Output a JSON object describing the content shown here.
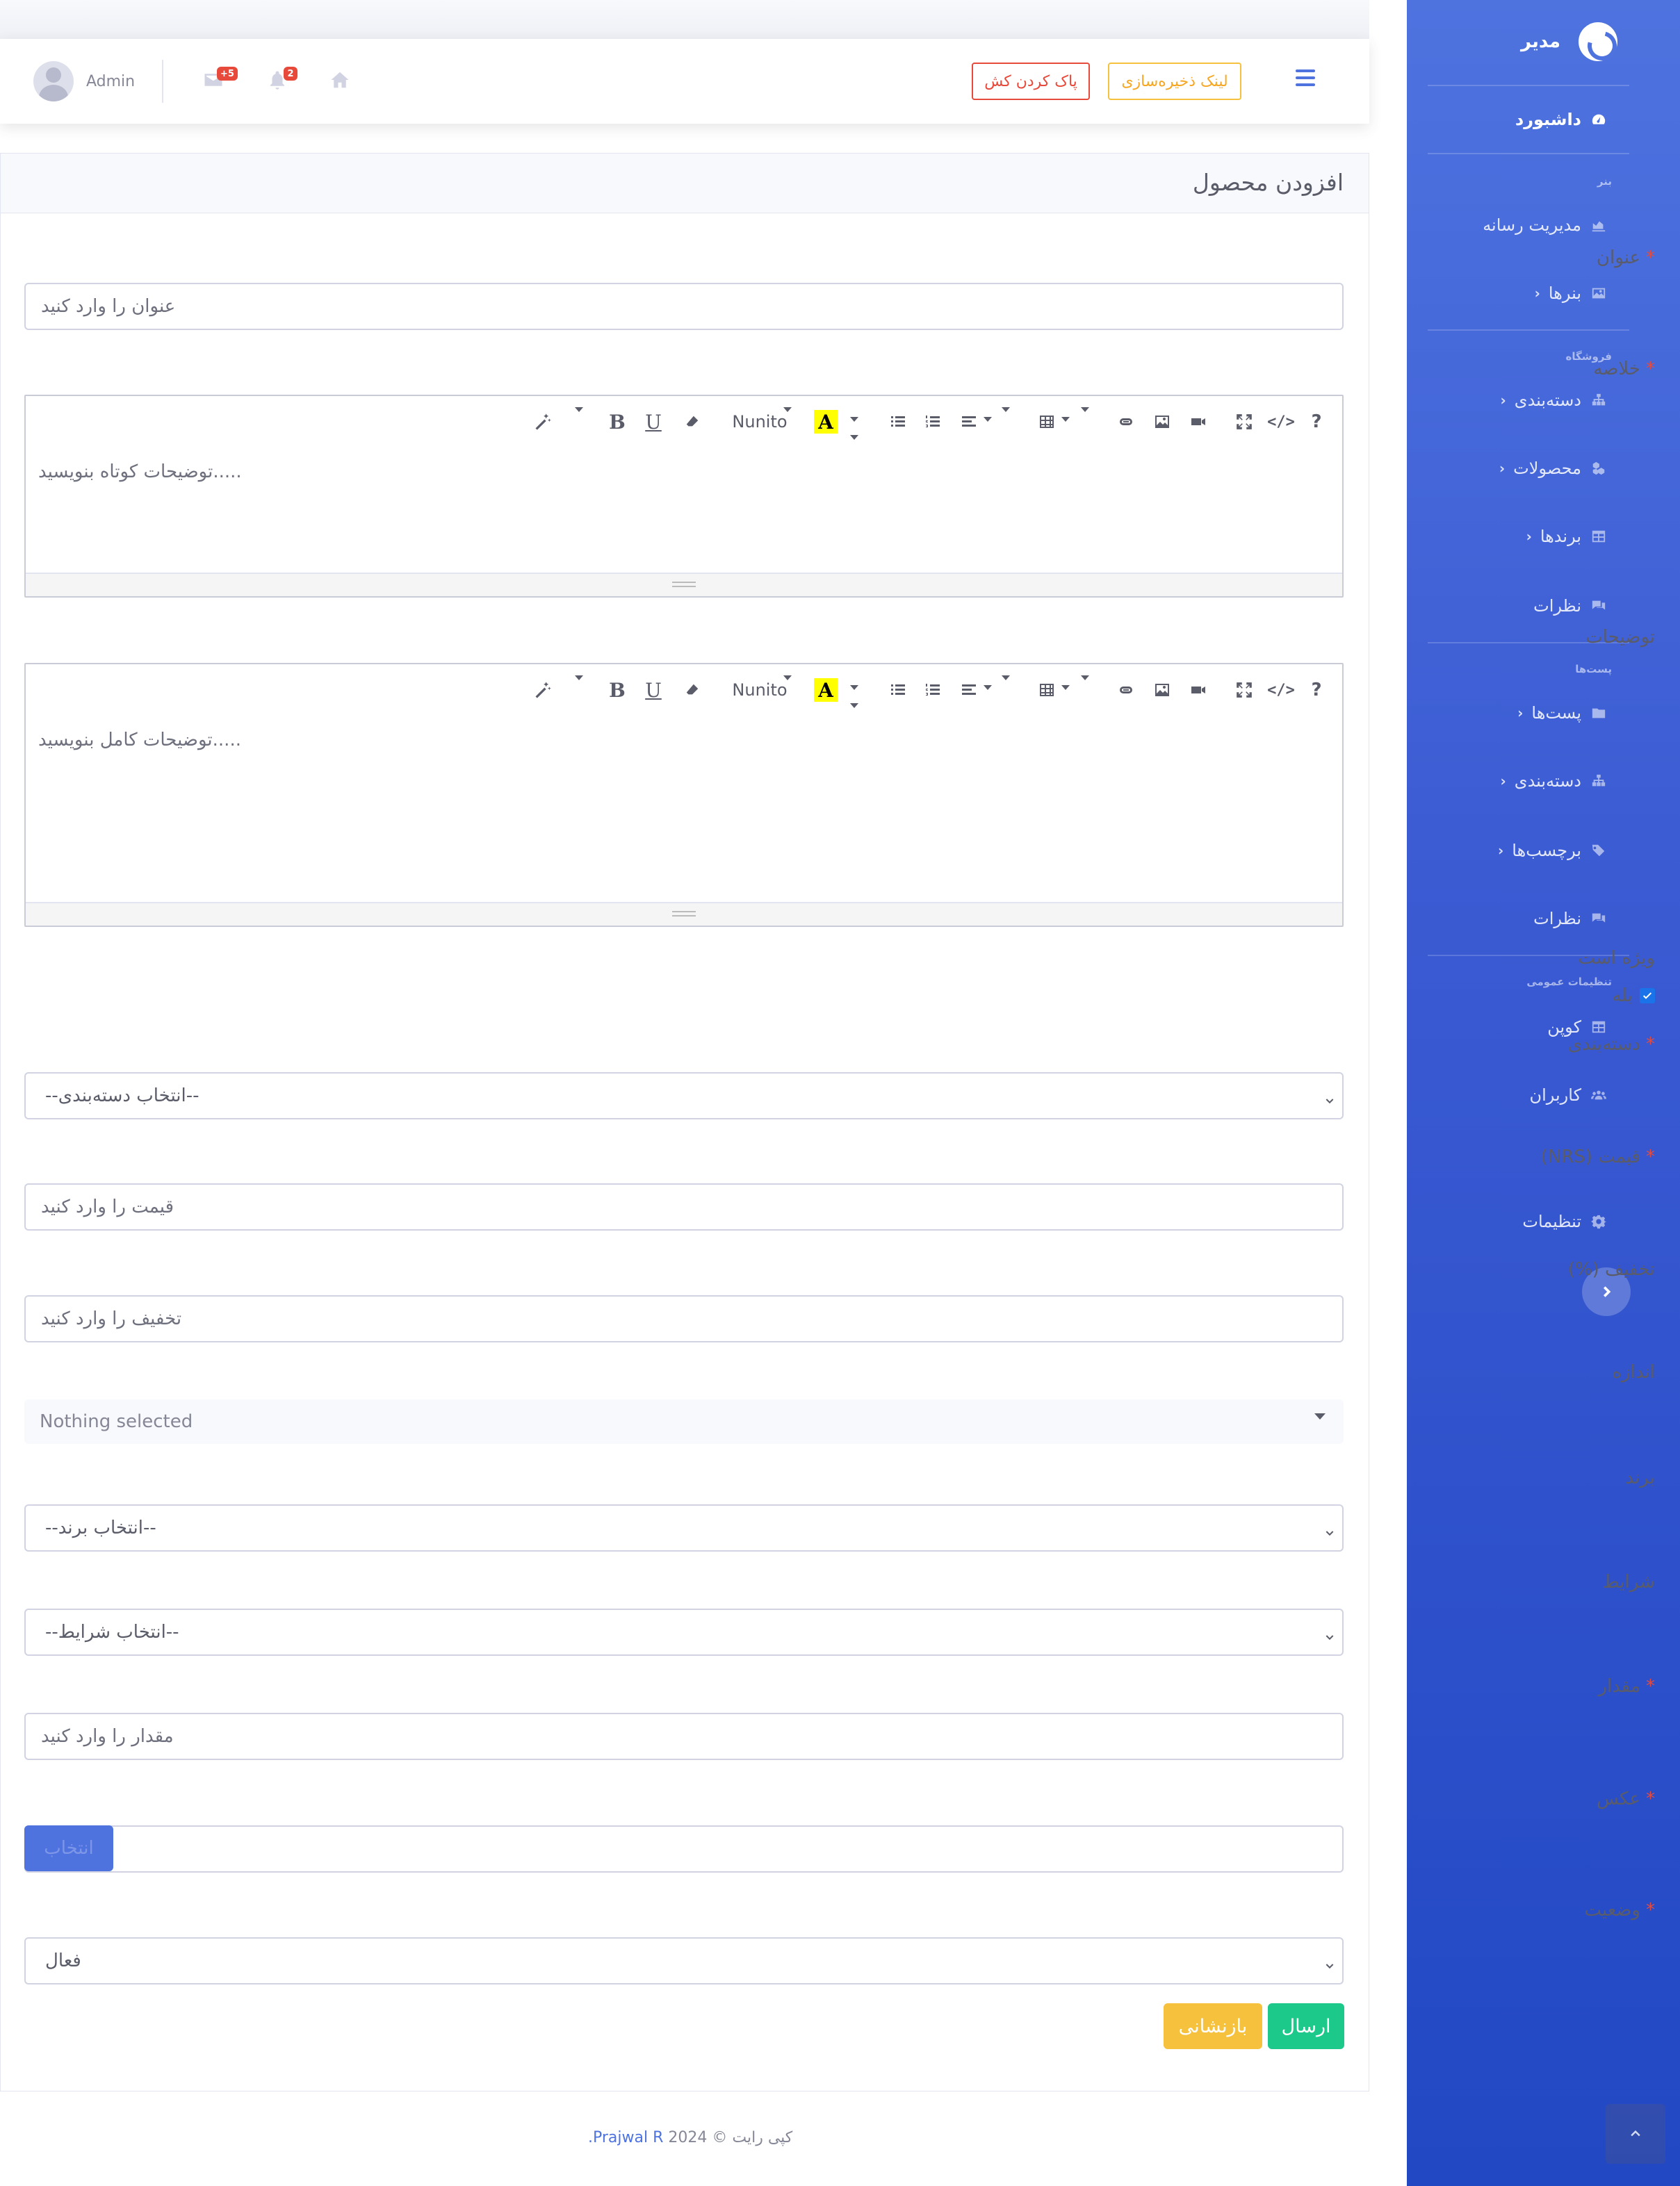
{
  "sidebar": {
    "brand": "مدیر",
    "dashboard": "داشبورد",
    "heading_banner": "بنر",
    "media": "مدیریت رسانه",
    "banners": "بنرها",
    "heading_shop": "فروشگاه",
    "categories": "دسته‌بندی",
    "products": "محصولات",
    "brands": "برندها",
    "comments": "نظرات",
    "heading_posts": "پست‌ها",
    "posts": "پست‌ها",
    "post_categories": "دسته‌بندی",
    "tags": "برچسب‌ها",
    "post_comments": "نظرات",
    "heading_general": "تنظیمات عمومی",
    "coupon": "کوپن",
    "users": "کاربران",
    "settings": "تنظیمات"
  },
  "topbar": {
    "storage_link": "لینک ذخیره‌سازی",
    "clear_cache": "پاک کردن کش",
    "notif_count": "2",
    "messages_count": "+5",
    "user_name": "Admin"
  },
  "form": {
    "page_title": "افزودن محصول",
    "title_label": "عنوان",
    "title_placeholder": "عنوان را وارد کنید",
    "summary_label": "خلاصه",
    "summary_placeholder": "توضیحات کوتاه بنویسید.....",
    "description_label": "توضیحات",
    "description_placeholder": "توضیحات کامل بنویسید.....",
    "font_name": "Nunito",
    "featured_label": "ویژه است",
    "featured_option": "بله",
    "featured_checked": true,
    "category_label": "دسته‌بندی",
    "category_value": "--انتخاب دسته‌بندی--",
    "price_label": "قیمت (NRS)",
    "price_placeholder": "قیمت را وارد کنید",
    "discount_label": "تخفیف (%)",
    "discount_placeholder": "تخفیف را وارد کنید",
    "size_label": "اندازه",
    "size_value": "Nothing selected",
    "brand_label": "برند",
    "brand_value": "--انتخاب برند--",
    "condition_label": "شرایط",
    "condition_value": "--انتخاب شرایط--",
    "quantity_label": "مقدار",
    "quantity_placeholder": "مقدار را وارد کنید",
    "photo_label": "عکس",
    "photo_button": "انتخاب",
    "status_label": "وضعیت",
    "status_value": "فعال",
    "submit": "ارسال",
    "reset": "بازنشانی",
    "required_mark": "*"
  },
  "footer": {
    "copyright": "کپی رایت © 2024",
    "author": "Prajwal R."
  },
  "colors": {
    "primary": "#4e73df",
    "success": "#1cc88a",
    "warning": "#f6c23e",
    "danger": "#e74a3b"
  }
}
